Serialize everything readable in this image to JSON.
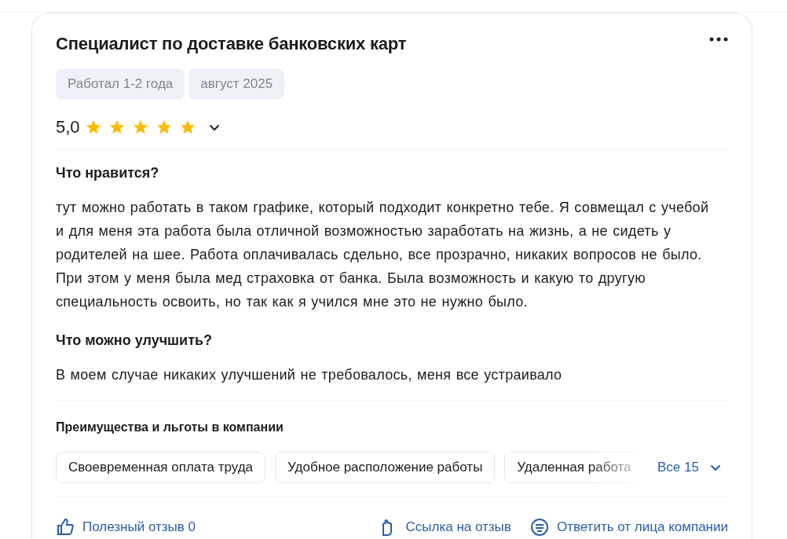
{
  "review": {
    "title": "Специалист по доставке банковских карт",
    "tags": [
      "Работал 1-2 года",
      "август 2025"
    ],
    "rating": "5,0",
    "stars": 5,
    "sections": [
      {
        "heading": "Что нравится?",
        "text": "тут можно работать в таком графике, который подходит конкретно тебе. Я совмещал с учебой и для меня эта работа была отличной возможностью заработать на жизнь, а не сидеть у родителей на шее. Работа оплачивалась сдельно, все прозрачно, никаких вопросов не было. При этом у меня была мед страховка от банка. Была возможность и какую то другую специальность освоить, но так как я учился мне это не нужно было."
      },
      {
        "heading": "Что можно улучшить?",
        "text": "В моем случае никаких улучшений не требовалось, меня все устраивало"
      }
    ],
    "benefits": {
      "heading": "Преимущества и льготы в компании",
      "items": [
        "Своевременная оплата труда",
        "Удобное расположение работы",
        "Удаленная работа"
      ],
      "more": "Все 15"
    },
    "actions": [
      {
        "kind": "like",
        "label": "Полезный отзыв 0"
      },
      {
        "kind": "link",
        "label": "Ссылка на отзыв"
      },
      {
        "kind": "reply",
        "label": "Ответить от лица компании"
      }
    ]
  }
}
